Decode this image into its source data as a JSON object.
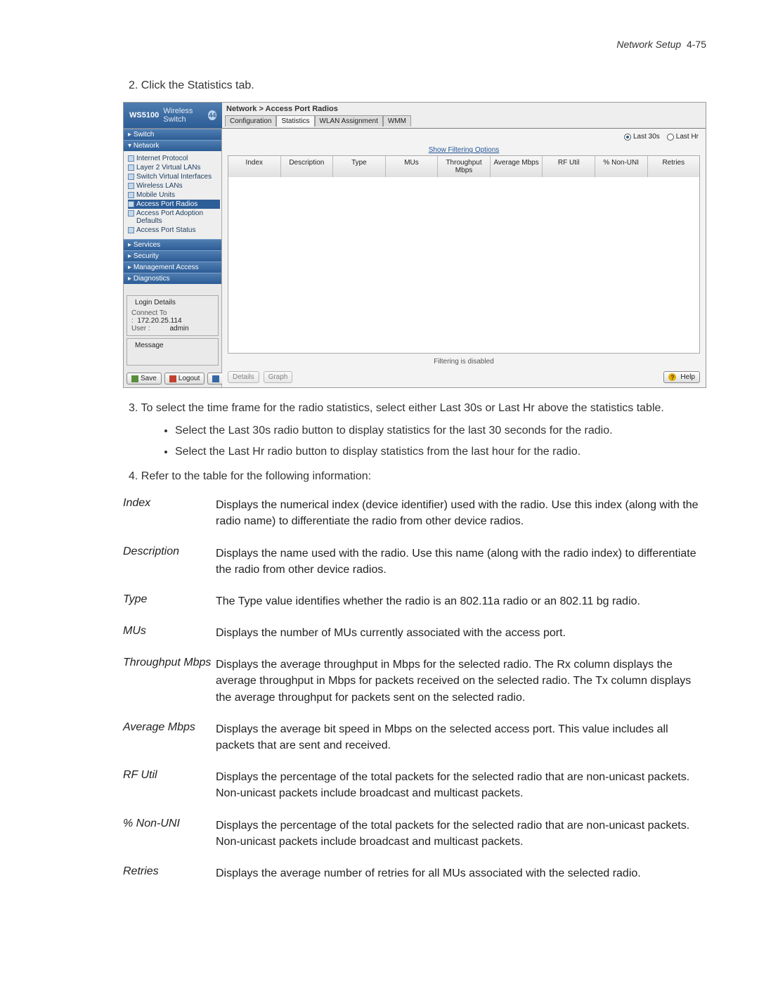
{
  "page_header": {
    "section": "Network Setup",
    "num": "4-75"
  },
  "steps": {
    "s2_pre": "Click the ",
    "s2_strong": "Statistics",
    "s2_post": " tab.",
    "s3_a": "To select the time frame for the radio statistics, select either ",
    "s3_b": "Last 30s",
    "s3_c": " or ",
    "s3_d": "Last Hr",
    "s3_e": " above the statistics table.",
    "bullet1": "Select the Last 30s radio button to display statistics for the last 30 seconds for the radio.",
    "bullet2": "Select the Last Hr radio button to display statistics from the last hour for the radio.",
    "s4": "Refer to the table for the following information:"
  },
  "ui": {
    "brand_a": "WS5100",
    "brand_b": "Wireless Switch",
    "brand_badge": "44",
    "breadcrumb_a": "Network",
    "breadcrumb_sep": " > ",
    "breadcrumb_b": "Access Port Radios",
    "tabs": [
      "Configuration",
      "Statistics",
      "WLAN Assignment",
      "WMM"
    ],
    "nav": {
      "switch": "Switch",
      "network": "Network",
      "services": "Services",
      "security": "Security",
      "mgmt": "Management Access",
      "diag": "Diagnostics"
    },
    "tree": [
      "Internet Protocol",
      "Layer 2 Virtual LANs",
      "Switch Virtual Interfaces",
      "Wireless LANs",
      "Mobile Units",
      "Access Port Radios",
      "Access Port Adoption Defaults",
      "Access Port Status"
    ],
    "login": {
      "title": "Login Details",
      "connect_lbl": "Connect To :",
      "connect_val": "172.20.25.114",
      "user_lbl": "User :",
      "user_val": "admin"
    },
    "message_title": "Message",
    "buttons": {
      "save": "Save",
      "logout": "Logout",
      "refresh": "Refresh",
      "details": "Details",
      "graph": "Graph",
      "help": "Help"
    },
    "timeframe": {
      "last30": "Last 30s",
      "lasthr": "Last Hr"
    },
    "sfo": "Show Filtering Options",
    "columns": [
      "Index",
      "Description",
      "Type",
      "MUs",
      "Throughput Mbps",
      "Average Mbps",
      "RF Util",
      "% Non-UNI",
      "Retries"
    ],
    "filter_msg": "Filtering is disabled"
  },
  "defs": [
    {
      "term": "Index",
      "desc": "Displays the numerical index (device identifier) used with the radio. Use this index (along with the radio name) to differentiate the radio from other device radios."
    },
    {
      "term": "Description",
      "desc": "Displays the name used with the radio. Use this name (along with the radio index) to differentiate the radio from other device radios."
    },
    {
      "term": "Type",
      "desc": "The Type value identifies whether the radio is an 802.11a radio or an 802.11 bg radio."
    },
    {
      "term": "MUs",
      "desc": "Displays the number of MUs currently associated with the access port."
    },
    {
      "term": "Throughput Mbps",
      "desc": "Displays the average throughput in Mbps for the selected radio. The Rx column displays the average throughput in Mbps for packets received on the selected radio. The Tx column displays the average throughput for packets sent on the selected radio."
    },
    {
      "term": "Average Mbps",
      "desc": "Displays the average bit speed in Mbps on the selected access port. This value includes all packets that are sent and received."
    },
    {
      "term": "RF Util",
      "desc": "Displays the percentage of the total packets for the selected radio that are non-unicast packets. Non-unicast packets include broadcast and multicast packets."
    },
    {
      "term": "% Non-UNI",
      "desc": "Displays the percentage of the total packets for the selected radio that are non-unicast packets. Non-unicast packets include broadcast and multicast packets."
    },
    {
      "term": "Retries",
      "desc": "Displays the average number of retries for all MUs associated with the selected radio."
    }
  ]
}
